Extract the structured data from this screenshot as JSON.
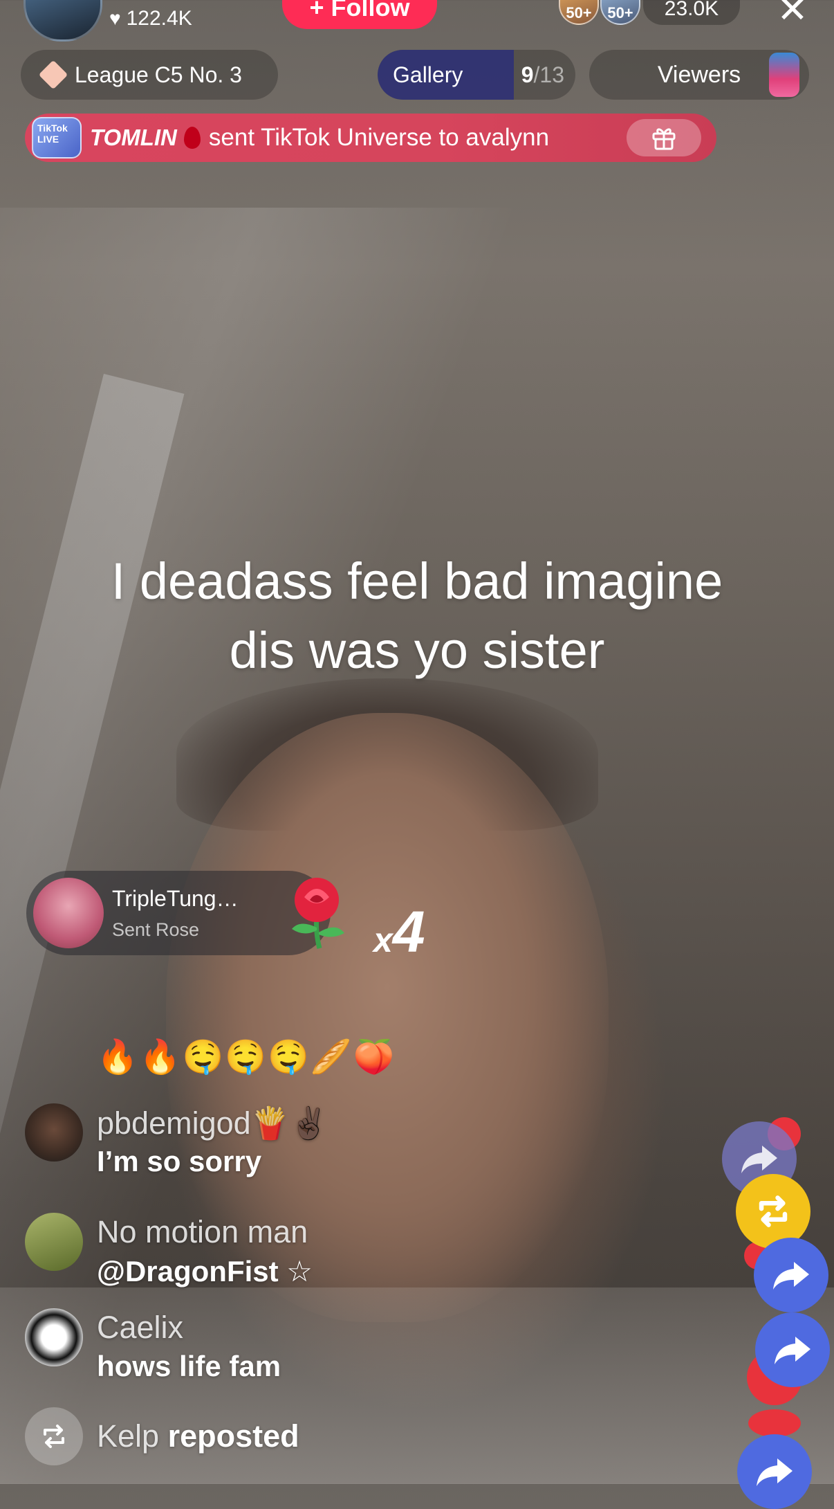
{
  "header": {
    "likes": "122.4K",
    "follow_label": "+ Follow",
    "top_viewer_badges": [
      "50+",
      "50+"
    ],
    "viewer_count": "23.0K",
    "close_glyph": "✕"
  },
  "pills": {
    "league": "League C5 No. 3",
    "gallery_label": "Gallery",
    "gallery_current": "9",
    "gallery_total": "/13",
    "gallery_progress": 0.69,
    "viewers_label": "Viewers"
  },
  "gift_banner": {
    "badge_text": "TikTok LIVE",
    "user": "TOMLIN",
    "text": "sent TikTok Universe to avalynn"
  },
  "caption": {
    "line1": "I deadass feel bad imagine",
    "line2": "dis was yo sister"
  },
  "gift_notification": {
    "name": "TripleTung…",
    "subtitle": "Sent Rose",
    "combo_x": "x",
    "combo_count": "4"
  },
  "emoji_line": "🔥🔥🤤🤤🤤🥖🍑",
  "comments": [
    {
      "user": "pbdemigod🍟✌🏿",
      "message": "I’m so sorry"
    },
    {
      "user": "No motion man",
      "message": "@DragonFist ☆"
    },
    {
      "user": "Caelix",
      "message": "hows life fam"
    }
  ],
  "repost": {
    "user": "Kelp",
    "verb": "reposted"
  },
  "colors": {
    "follow": "#fe2c55",
    "gift_banner": "#d8455e",
    "share_bubble": "#4f6ae0",
    "repost_bubble": "#f3c21a"
  },
  "icons": [
    "heart-icon",
    "close-icon",
    "diamond-icon",
    "gift-icon",
    "rose-icon",
    "repost-icon",
    "share-icon"
  ]
}
